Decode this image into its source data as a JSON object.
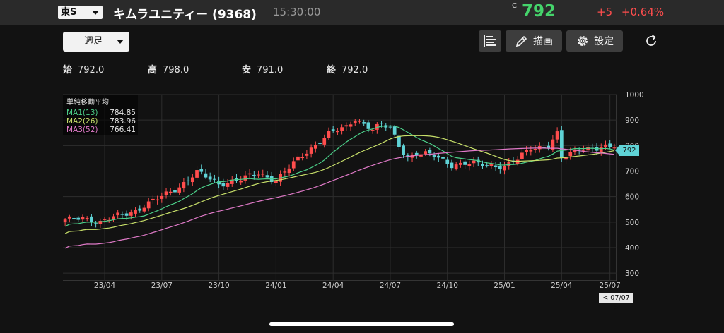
{
  "header": {
    "market": "東S",
    "name": "キムラユニティー (9368)",
    "time": "15:30:00",
    "c_mark": "C",
    "price": "792",
    "change": "+5",
    "change_pct": "+0.64%"
  },
  "toolbar": {
    "period": "週足",
    "draw_label": "描画",
    "settings_label": "設定"
  },
  "ohlc": {
    "open_label": "始",
    "open": "792.0",
    "high_label": "高",
    "high": "798.0",
    "low_label": "安",
    "low": "791.0",
    "close_label": "終",
    "close": "792.0"
  },
  "indicators": {
    "title": "単純移動平均",
    "ma": [
      {
        "name": "MA1(13)",
        "value": "784.85",
        "color": "#4cd08a"
      },
      {
        "name": "MA2(26)",
        "value": "783.96",
        "color": "#c8e06a"
      },
      {
        "name": "MA3(52)",
        "value": "766.41",
        "color": "#e07ac8"
      }
    ]
  },
  "price_tag": "792",
  "date_tag": "< 07/07 >",
  "colors": {
    "up": "#ff4d4d",
    "down": "#5fd3d6",
    "accent_green": "#45d36b"
  },
  "chart_data": {
    "type": "candlestick",
    "ylim": [
      270,
      1000
    ],
    "y_ticks": [
      1000,
      900,
      800,
      700,
      600,
      500,
      400,
      300
    ],
    "x_ticks": [
      "23/04",
      "23/07",
      "23/10",
      "24/01",
      "24/04",
      "24/07",
      "24/10",
      "25/01",
      "25/04",
      "25/07"
    ],
    "x_tick_index": [
      9,
      22,
      35,
      48,
      61,
      74,
      87,
      100,
      113,
      124
    ],
    "grid": true,
    "close_anchors": [
      [
        0,
        505
      ],
      [
        4,
        520
      ],
      [
        8,
        498
      ],
      [
        12,
        525
      ],
      [
        16,
        545
      ],
      [
        22,
        600
      ],
      [
        26,
        640
      ],
      [
        30,
        695
      ],
      [
        35,
        650
      ],
      [
        40,
        668
      ],
      [
        44,
        690
      ],
      [
        48,
        665
      ],
      [
        52,
        730
      ],
      [
        56,
        790
      ],
      [
        60,
        850
      ],
      [
        64,
        870
      ],
      [
        66,
        905
      ],
      [
        70,
        865
      ],
      [
        72,
        880
      ],
      [
        74,
        868
      ],
      [
        76,
        800
      ],
      [
        78,
        755
      ],
      [
        80,
        770
      ],
      [
        84,
        760
      ],
      [
        88,
        725
      ],
      [
        92,
        730
      ],
      [
        96,
        722
      ],
      [
        100,
        720
      ],
      [
        103,
        745
      ],
      [
        106,
        790
      ],
      [
        110,
        800
      ],
      [
        112,
        845
      ],
      [
        113,
        750
      ],
      [
        115,
        765
      ],
      [
        118,
        792
      ],
      [
        121,
        790
      ],
      [
        124,
        792
      ]
    ],
    "ma_last": {
      "MA1(13)": 784.85,
      "MA2(26)": 783.96,
      "MA3(52)": 766.41
    },
    "last_close": 792
  }
}
